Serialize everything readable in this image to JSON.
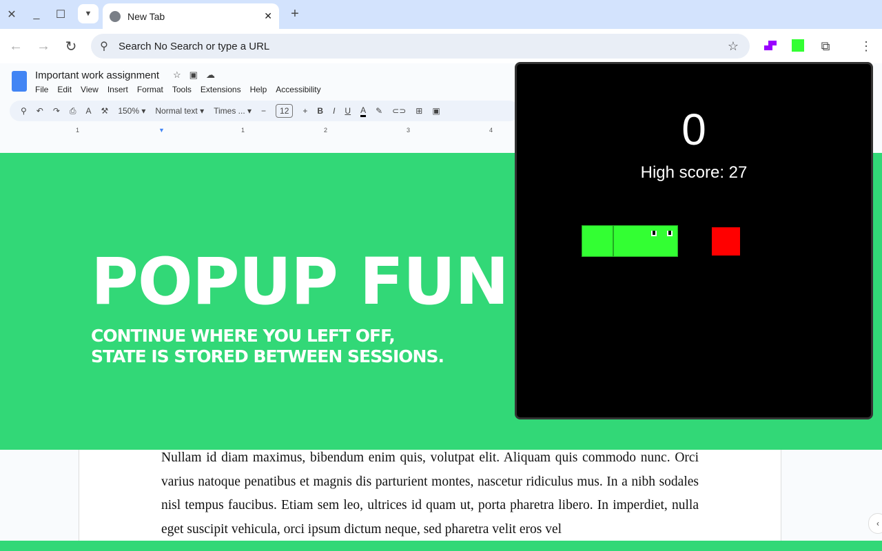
{
  "browser": {
    "tab_title": "New Tab",
    "omnibox_placeholder": "Search No Search or type a URL"
  },
  "doc": {
    "title": "Important work assignment",
    "menu": [
      "File",
      "Edit",
      "View",
      "Insert",
      "Format",
      "Tools",
      "Extensions",
      "Help",
      "Accessibility"
    ],
    "toolbar": {
      "zoom": "150%",
      "style": "Normal text",
      "font": "Times ...",
      "font_size": "12"
    },
    "ruler": [
      "1",
      "1",
      "2",
      "3",
      "4"
    ],
    "body_text": "Nullam id diam maximus, bibendum enim quis, volutpat elit. Aliquam quis commodo nunc. Orci varius natoque penatibus et magnis dis parturient montes, nascetur ridiculus mus. In a nibh sodales nisl tempus faucibus. Etiam sem leo, ultrices id quam ut, porta pharetra libero. In imperdiet, nulla eget suscipit vehicula, orci ipsum dictum neque, sed pharetra velit eros vel"
  },
  "promo": {
    "title": "POPUP FUN",
    "subtitle": "CONTINUE WHERE YOU LEFT OFF, STATE IS STORED BETWEEN SESSIONS."
  },
  "game": {
    "score": "0",
    "high_score": "High score: 27",
    "colors": {
      "snake": "#33ff33",
      "food": "#ff0000",
      "background": "#000000"
    }
  },
  "colors": {
    "promo_green": "#32d877"
  }
}
